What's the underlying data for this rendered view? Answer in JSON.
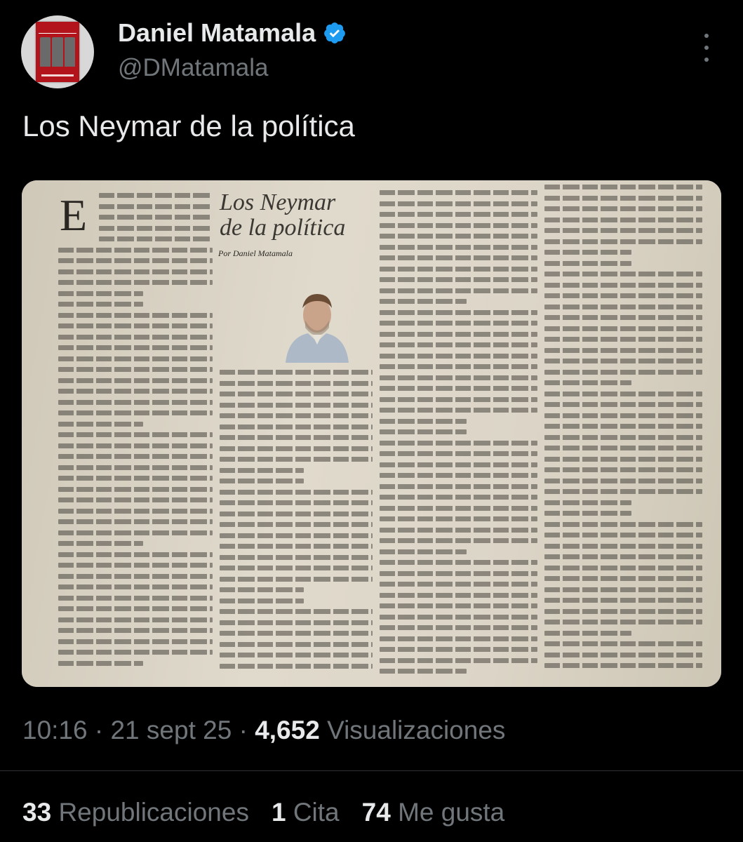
{
  "author": {
    "name": "Daniel Matamala",
    "handle": "@DMatamala"
  },
  "tweet": {
    "text": "Los Neymar de la política"
  },
  "article": {
    "headline_line1": "Los Neymar",
    "headline_line2": "de la política",
    "byline": "Por Daniel Matamala",
    "drop_cap": "E"
  },
  "meta": {
    "time": "10:16",
    "date": "21 sept 25",
    "views_count": "4,652",
    "views_label": "Visualizaciones"
  },
  "stats": {
    "reposts_count": "33",
    "reposts_label": "Republicaciones",
    "quotes_count": "1",
    "quotes_label": "Cita",
    "likes_count": "74",
    "likes_label": "Me gusta"
  },
  "colors": {
    "background": "#000000",
    "verified": "#1d9bf0",
    "secondary_text": "#71767b"
  }
}
